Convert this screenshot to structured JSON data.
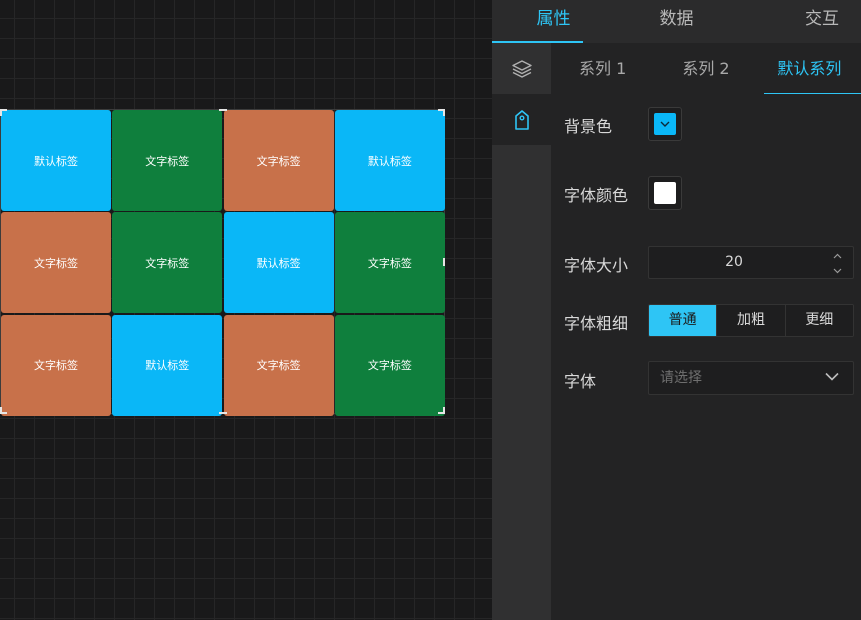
{
  "canvas": {
    "cells": [
      {
        "label": "默认标签",
        "color": "#0ab7f7"
      },
      {
        "label": "文字标签",
        "color": "#0f7f3d"
      },
      {
        "label": "文字标签",
        "color": "#c8714a"
      },
      {
        "label": "默认标签",
        "color": "#0ab7f7"
      },
      {
        "label": "文字标签",
        "color": "#c8714a"
      },
      {
        "label": "文字标签",
        "color": "#0f7f3d"
      },
      {
        "label": "默认标签",
        "color": "#0ab7f7"
      },
      {
        "label": "文字标签",
        "color": "#0f7f3d"
      },
      {
        "label": "文字标签",
        "color": "#c8714a"
      },
      {
        "label": "默认标签",
        "color": "#0ab7f7"
      },
      {
        "label": "文字标签",
        "color": "#c8714a"
      },
      {
        "label": "文字标签",
        "color": "#0f7f3d"
      }
    ]
  },
  "panel": {
    "top_tabs": [
      {
        "label": "属性",
        "active": true
      },
      {
        "label": "数据",
        "active": false
      },
      {
        "label": "交互",
        "active": false
      }
    ],
    "rail_icons": [
      "layers-icon",
      "tag-icon"
    ],
    "series_tabs": [
      {
        "label": "系列 1",
        "active": false
      },
      {
        "label": "系列 2",
        "active": false
      },
      {
        "label": "默认系列",
        "active": true
      }
    ],
    "background_color_label": "背景色",
    "background_color": "#0ab7f7",
    "font_color_label": "字体颜色",
    "font_color": "#ffffff",
    "font_size_label": "字体大小",
    "font_size_value": "20",
    "font_weight_label": "字体粗细",
    "font_weight_options": [
      {
        "label": "普通",
        "active": true
      },
      {
        "label": "加粗",
        "active": false
      },
      {
        "label": "更细",
        "active": false
      }
    ],
    "font_family_label": "字体",
    "font_family_placeholder": "请选择"
  },
  "colors": {
    "accent": "#2ec5f5",
    "blue": "#0ab7f7",
    "green": "#0f7f3d",
    "orange": "#c8714a"
  }
}
